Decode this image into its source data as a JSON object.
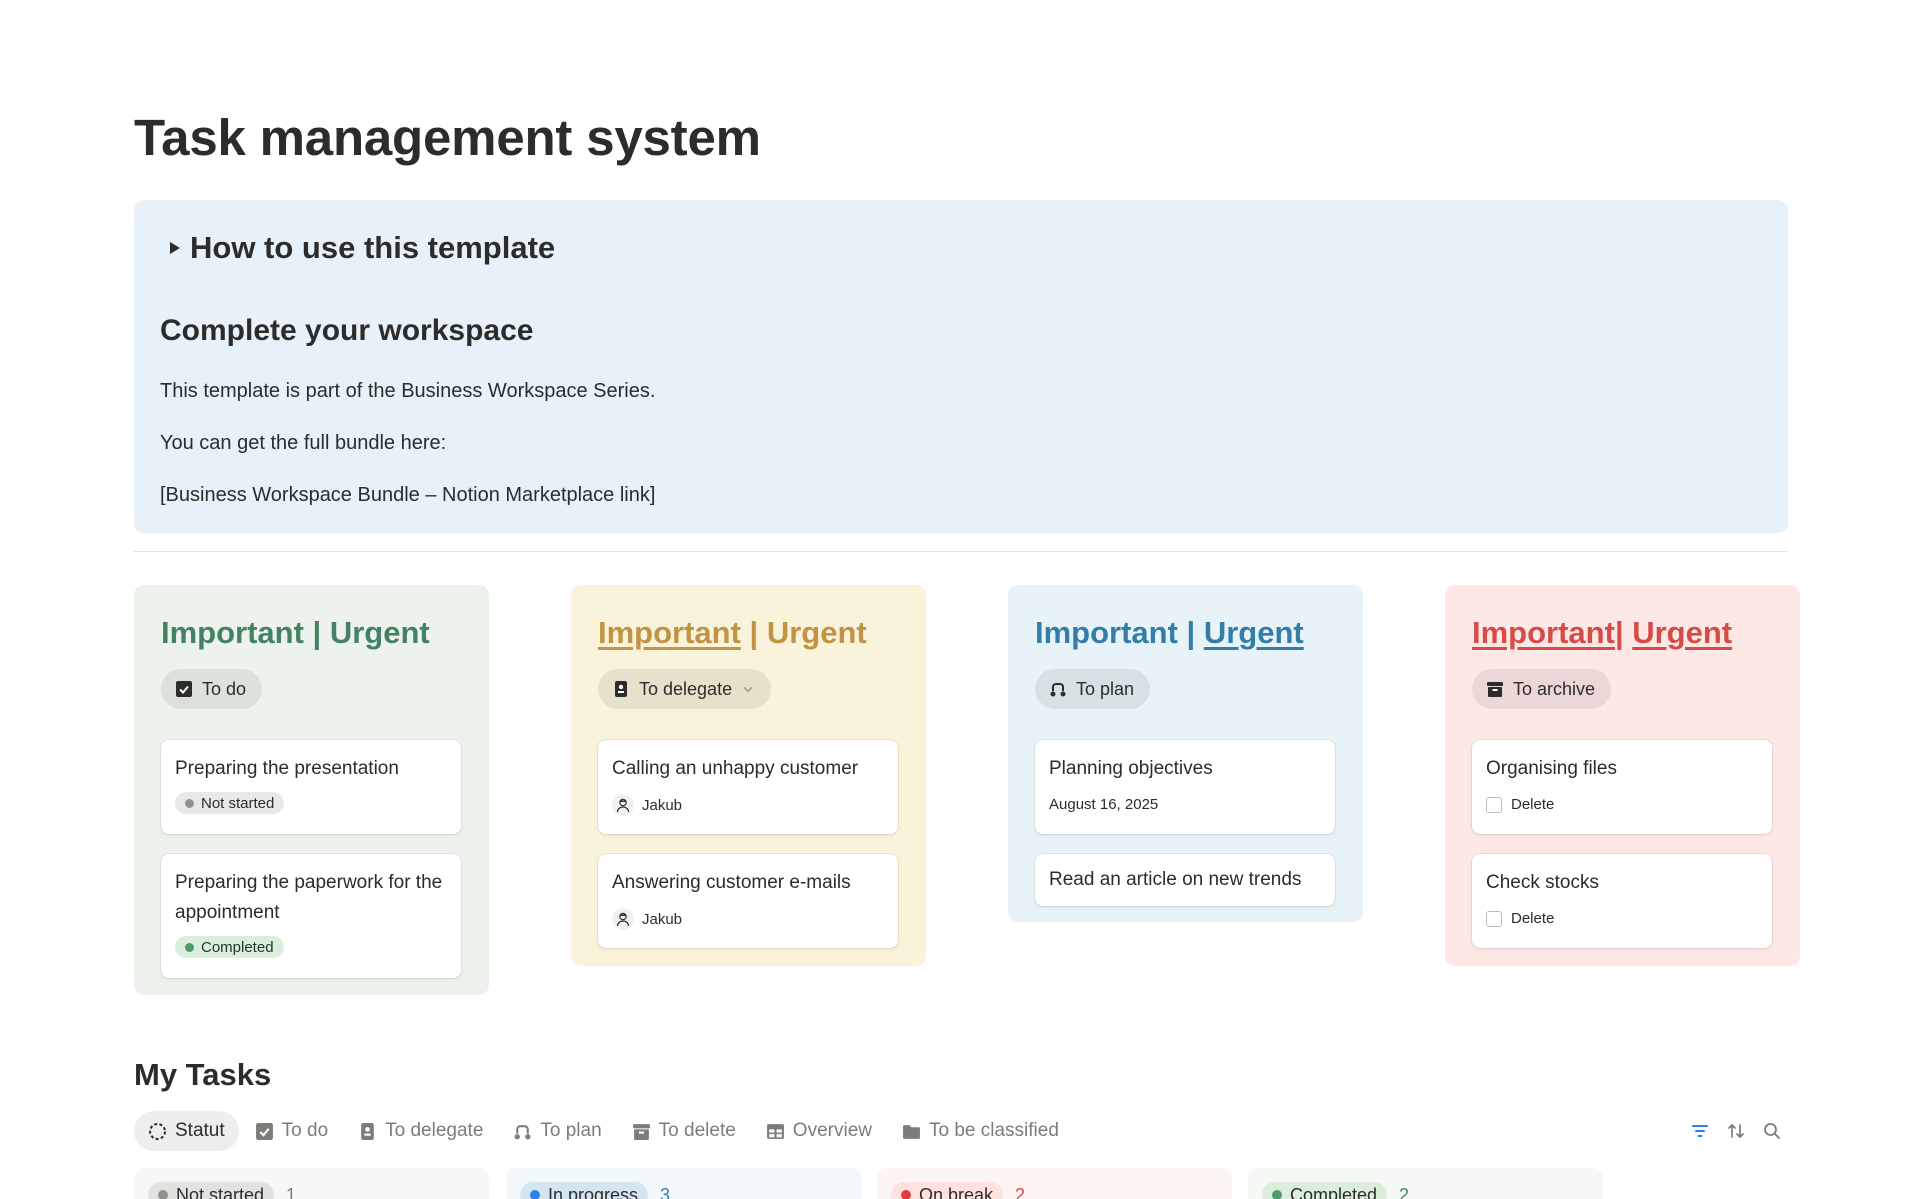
{
  "page": {
    "title": "Task management system"
  },
  "callout": {
    "toggle_title": "How to use this template",
    "heading": "Complete your workspace",
    "paragraphs": [
      "This template is part of the Business Workspace Series.",
      "You can get the full bundle here:",
      "[Business Workspace Bundle – Notion Marketplace link]"
    ]
  },
  "quadrants": [
    {
      "title_a": "Important",
      "title_sep": " | ",
      "title_b": "Urgent",
      "color": "#448361",
      "background": "#edf3ec",
      "tag": "To do",
      "tag_icon": "checkbox-icon",
      "cards": [
        {
          "title": "Preparing the presentation",
          "status": "Not started"
        },
        {
          "title": "Preparing the paperwork for the appointment",
          "status": "Completed"
        }
      ]
    },
    {
      "title_a": "Important",
      "title_sep": " | ",
      "title_b": "Urgent",
      "color": "#c29343",
      "background": "#f9f3dc",
      "tag": "To delegate",
      "tag_icon": "badge-icon",
      "cards": [
        {
          "title": "Calling an unhappy customer",
          "person": "Jakub"
        },
        {
          "title": "Answering customer e-mails",
          "person": "Jakub"
        }
      ]
    },
    {
      "title_a": "Important",
      "title_sep": " | ",
      "title_b": "Urgent",
      "color": "#337ea9",
      "background": "#e7f3f8",
      "tag": "To plan",
      "tag_icon": "route-icon",
      "cards": [
        {
          "title": "Planning objectives",
          "date": "August 16, 2025"
        },
        {
          "title": "Read an article on new trends"
        }
      ]
    },
    {
      "title_a": "Important",
      "title_sep": "| ",
      "title_b": "Urgent",
      "color": "#d44c47",
      "background": "#fde8e6",
      "tag": "To archive",
      "tag_icon": "archive-icon",
      "cards": [
        {
          "title": "Organising files",
          "checkbox": "Delete"
        },
        {
          "title": "Check stocks",
          "checkbox": "Delete"
        }
      ]
    }
  ],
  "tasks": {
    "title": "My Tasks",
    "views": [
      {
        "label": "Statut",
        "icon": "status-icon",
        "active": true
      },
      {
        "label": "To do",
        "icon": "checkbox-icon"
      },
      {
        "label": "To delegate",
        "icon": "badge-icon"
      },
      {
        "label": "To plan",
        "icon": "route-icon"
      },
      {
        "label": "To delete",
        "icon": "archive-icon"
      },
      {
        "label": "Overview",
        "icon": "table-icon"
      },
      {
        "label": "To be classified",
        "icon": "folder-icon"
      }
    ],
    "tools": [
      "filter-icon",
      "sort-icon",
      "search-icon"
    ],
    "columns": [
      {
        "label": "Not started",
        "count": "1",
        "dot": "#91918e",
        "pill_bg": "#e3e2e0",
        "col_bg": "#f7f7f5",
        "count_color": "#7d7c78"
      },
      {
        "label": "In progress",
        "count": "3",
        "dot": "#2f80ed",
        "pill_bg": "#d3e5ef",
        "col_bg": "#f3f8fb",
        "count_color": "#337ea9"
      },
      {
        "label": "On break",
        "count": "2",
        "dot": "#e03e3e",
        "pill_bg": "#ffe2dd",
        "col_bg": "#fdf5f3",
        "count_color": "#d44c47"
      },
      {
        "label": "Completed",
        "count": "2",
        "dot": "#4d9a6a",
        "pill_bg": "#dbeddb",
        "col_bg": "#f5f8f4",
        "count_color": "#448361"
      }
    ]
  },
  "status_colors": {
    "Not started": {
      "bg": "#e9e8e6",
      "dot": "#91918e",
      "text": "#2c2c2b"
    },
    "Completed": {
      "bg": "#dbeddb",
      "dot": "#4d9a6a",
      "text": "#1c3829"
    }
  }
}
